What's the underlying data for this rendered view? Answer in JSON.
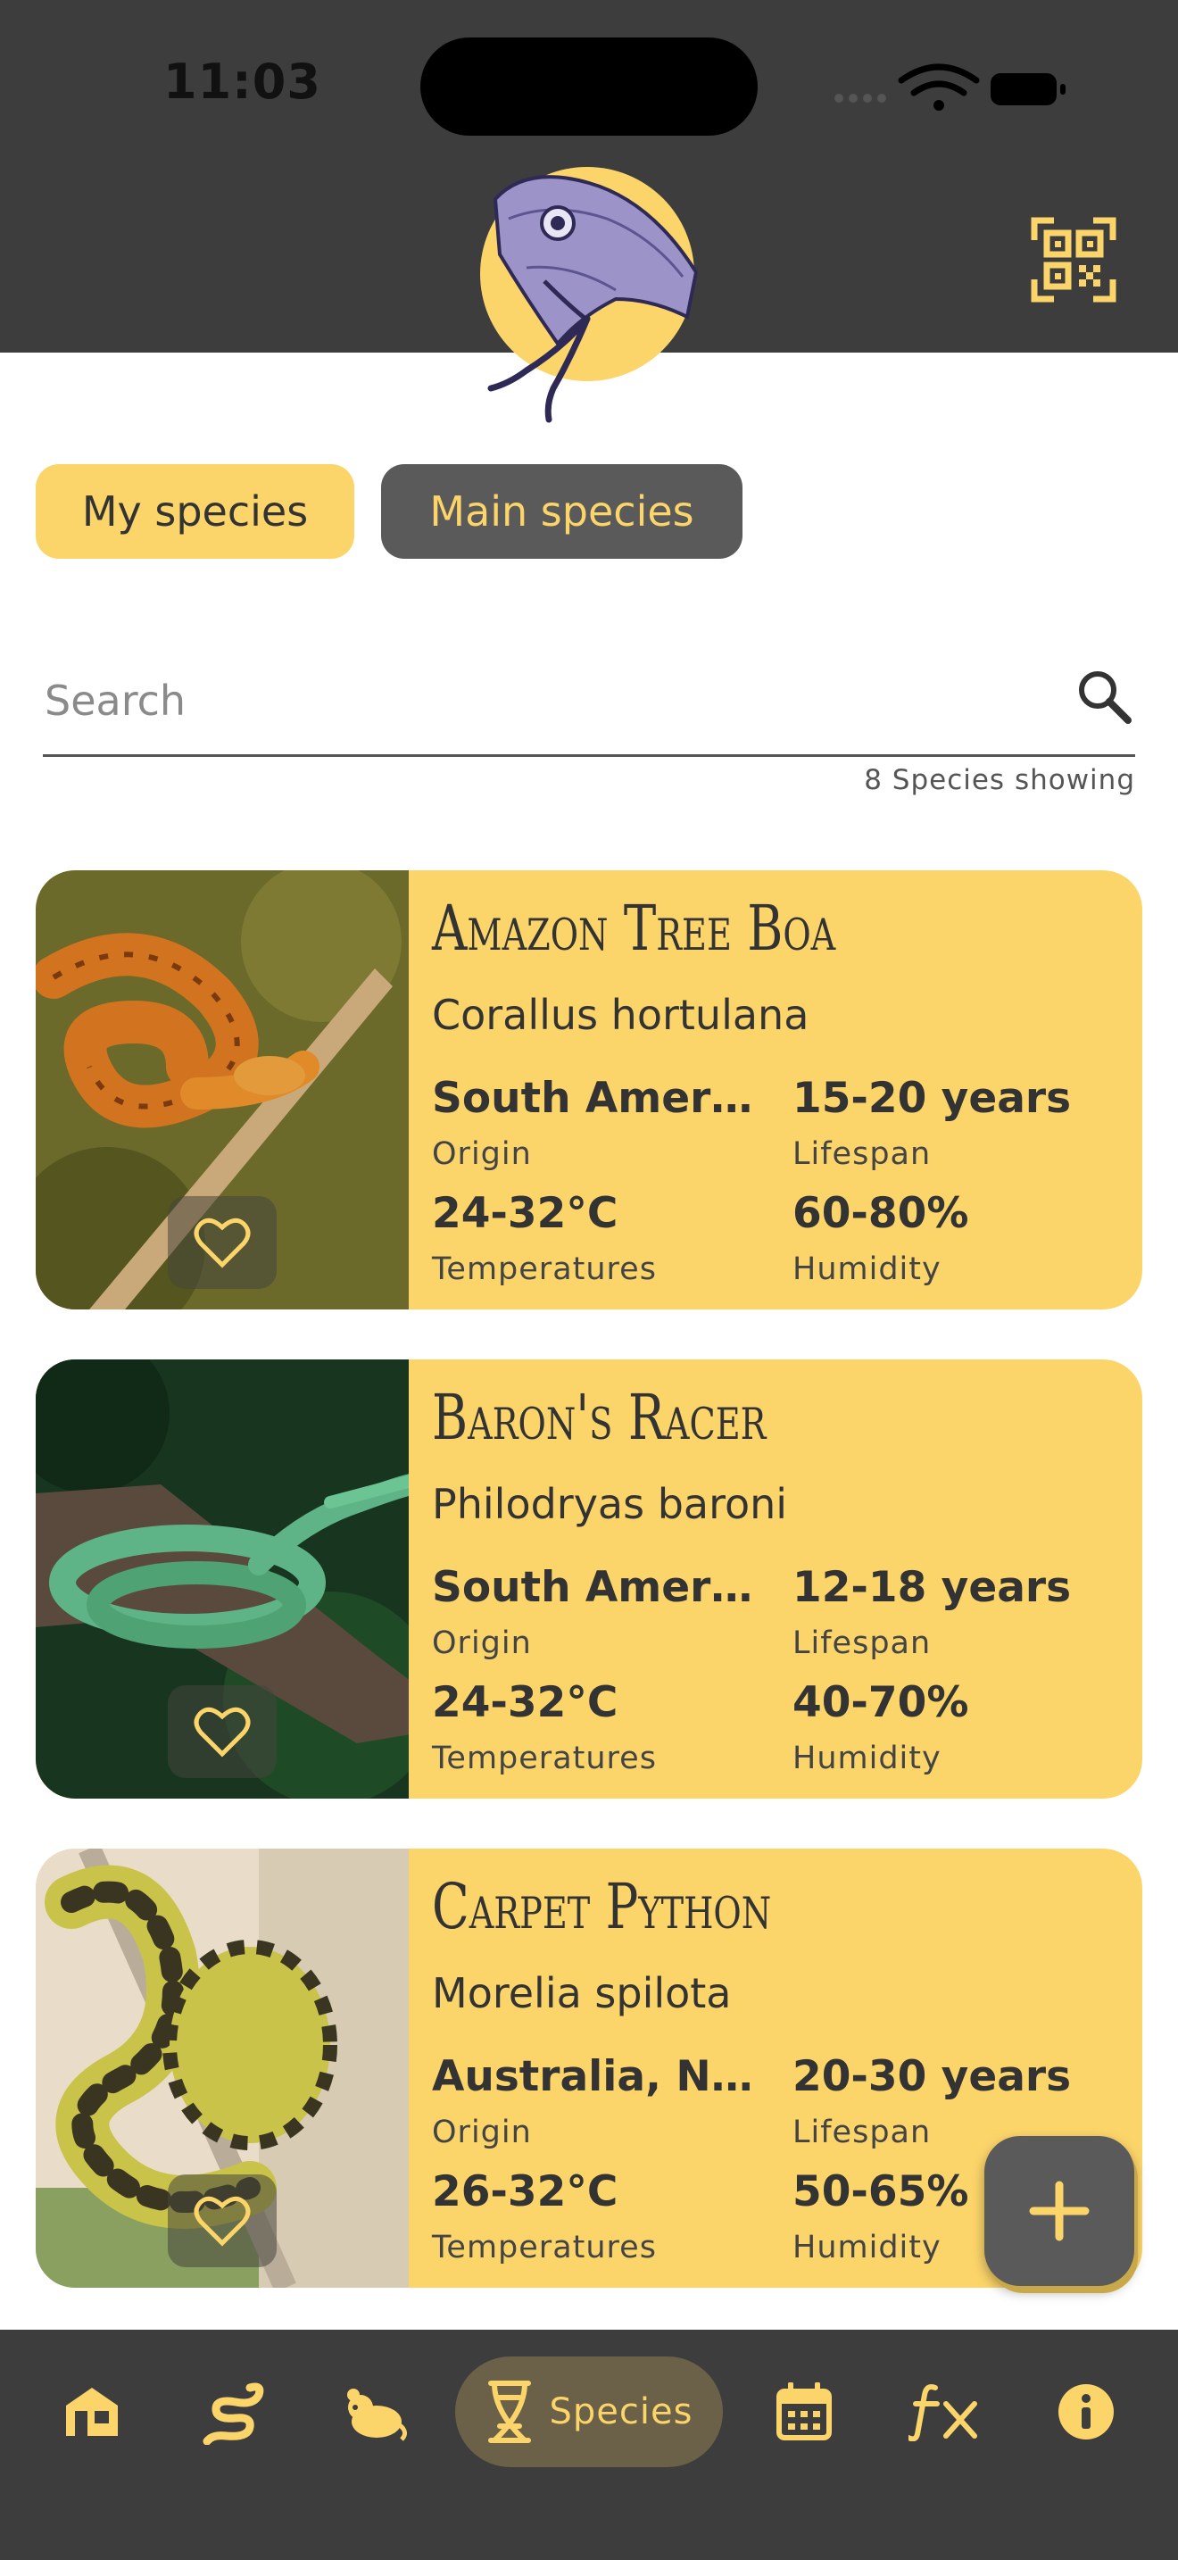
{
  "status_bar": {
    "time": "11:03"
  },
  "tabs": {
    "mine": "My species",
    "main": "Main species"
  },
  "search": {
    "placeholder": "Search",
    "count": "8 Species showing"
  },
  "cards": [
    {
      "name": "Amazon Tree Boa",
      "scientific": "Corallus hortulana",
      "origin": "South Americ...",
      "origin_label": "Origin",
      "lifespan": "15-20 years",
      "lifespan_label": "Lifespan",
      "temperature": "24-32°C",
      "temperature_label": "Temperatures",
      "humidity": "60-80%",
      "humidity_label": "Humidity"
    },
    {
      "name": "Baron's Racer",
      "scientific": "Philodryas baroni",
      "origin": "South Americ...",
      "origin_label": "Origin",
      "lifespan": "12-18 years",
      "lifespan_label": "Lifespan",
      "temperature": "24-32°C",
      "temperature_label": "Temperatures",
      "humidity": "40-70%",
      "humidity_label": "Humidity"
    },
    {
      "name": "Carpet Python",
      "scientific": "Morelia spilota",
      "origin": "Australia, Ne...",
      "origin_label": "Origin",
      "lifespan": "20-30 years",
      "lifespan_label": "Lifespan",
      "temperature": "26-32°C",
      "temperature_label": "Temperatures",
      "humidity": "50-65%",
      "humidity_label": "Humidity"
    }
  ],
  "bottom_nav": {
    "items": [
      {
        "icon": "home-icon"
      },
      {
        "icon": "snake-icon"
      },
      {
        "icon": "feeder-icon"
      },
      {
        "icon": "dna-icon",
        "label": "Species",
        "active": true
      },
      {
        "icon": "calendar-icon"
      },
      {
        "icon": "fx-icon"
      },
      {
        "icon": "info-icon"
      }
    ]
  },
  "colors": {
    "accent": "#fcd56a",
    "dark": "#3d3d3d",
    "button_dark": "#5a5a5a"
  }
}
